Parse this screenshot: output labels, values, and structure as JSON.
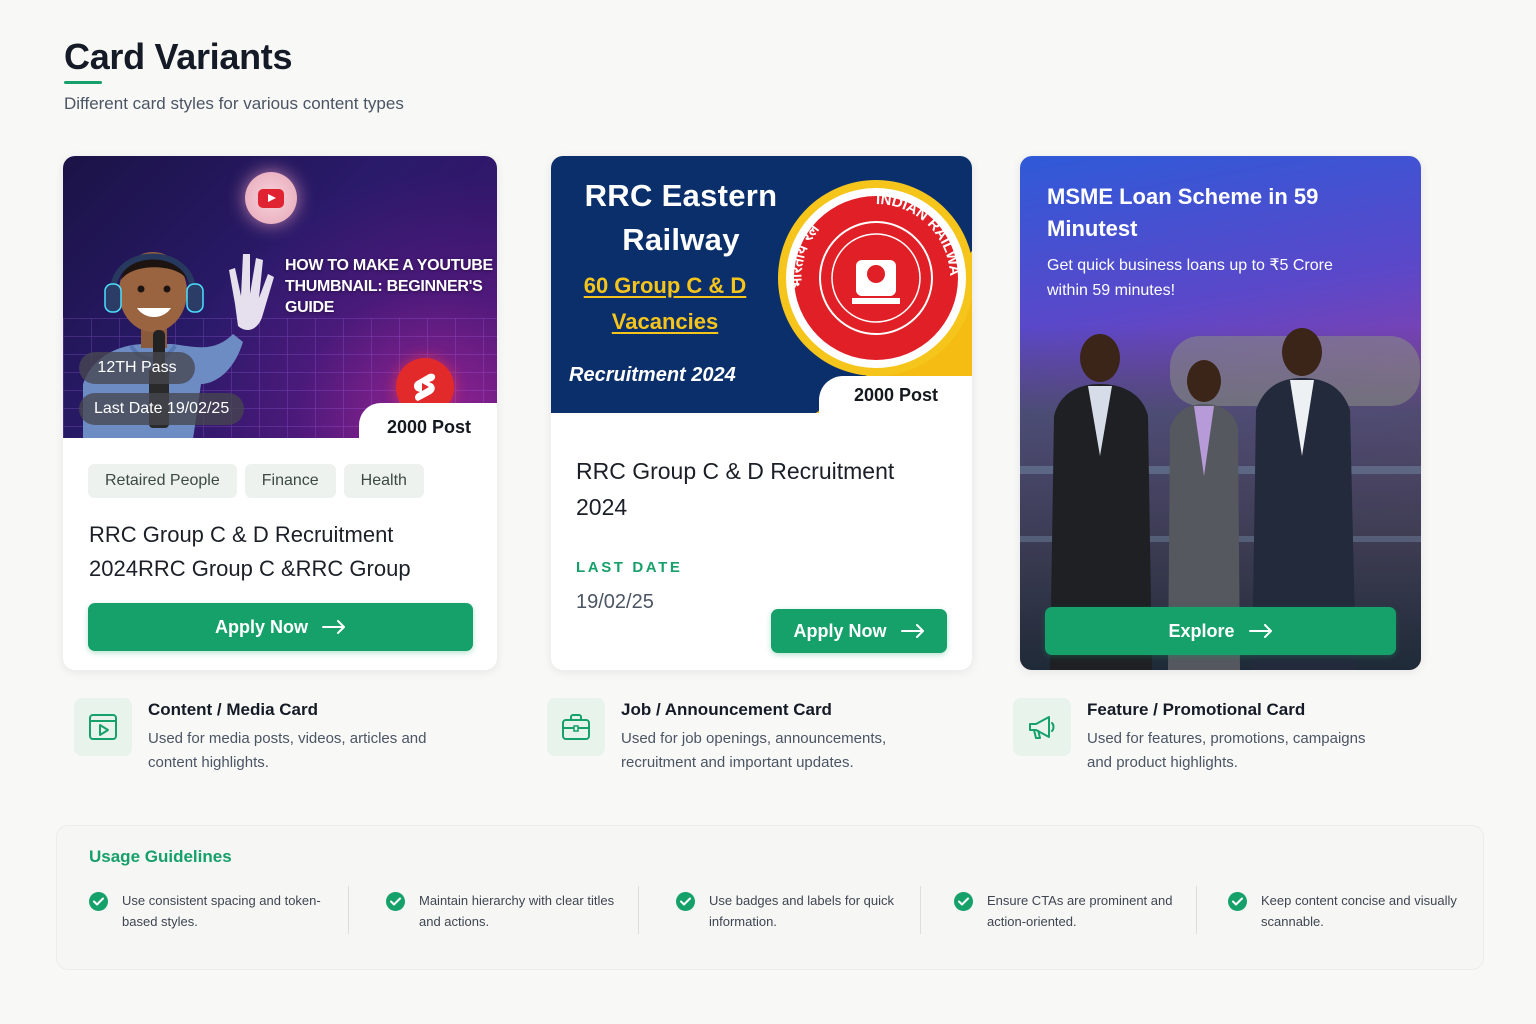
{
  "header": {
    "title": "Card Variants",
    "subtitle": "Different card styles for various content types"
  },
  "colors": {
    "accent": "#16a06a",
    "navy": "#0b2f6b",
    "yellow": "#f6c51c"
  },
  "media_card": {
    "headline": "HOW TO MAKE A YOUTUBE THUMBNAIL: BEGINNER'S GUIDE",
    "qualification": "12TH Pass",
    "last_date": "Last Date 19/02/25",
    "posts": "2000 Post",
    "tags": [
      "Retaired People",
      "Finance",
      "Health"
    ],
    "title": "RRC Group C & D Recruitment 2024RRC Group C &RRC Group",
    "cta": "Apply Now",
    "icons": [
      "youtube-icon",
      "shorts-icon",
      "arrow-right-icon"
    ]
  },
  "job_card": {
    "banner_title": "RRC Eastern Railway",
    "banner_subtitle": "60 Group C & D Vacancies",
    "banner_tag": "Recruitment 2024",
    "logo_text": "INDIAN RAILWAYS",
    "logo_text_hindi": "भारतीय रेल",
    "posts": "2000 Post",
    "title": "RRC Group C & D Recruitment 2024",
    "last_date_label": "LAST DATE",
    "last_date_value": "19/02/25",
    "cta": "Apply Now"
  },
  "promo_card": {
    "title": "MSME Loan Scheme in 59 Minutest",
    "description": "Get quick business loans up to ₹5 Crore within 59 minutes!",
    "cta": "Explore"
  },
  "descriptors": [
    {
      "title": "Content / Media Card",
      "text": "Used for media posts, videos, articles and content highlights.",
      "icon": "media-play-icon"
    },
    {
      "title": "Job / Announcement Card",
      "text": "Used for job openings, announcements, recruitment and important updates.",
      "icon": "briefcase-icon"
    },
    {
      "title": "Feature / Promotional Card",
      "text": "Used for features, promotions, campaigns and product highlights.",
      "icon": "megaphone-icon"
    }
  ],
  "guidelines": {
    "title": "Usage Guidelines",
    "items": [
      "Use consistent spacing and token-based styles.",
      "Maintain hierarchy with clear titles and actions.",
      "Use badges and labels for quick information.",
      "Ensure CTAs are prominent and action-oriented.",
      "Keep content concise and visually scannable."
    ]
  }
}
